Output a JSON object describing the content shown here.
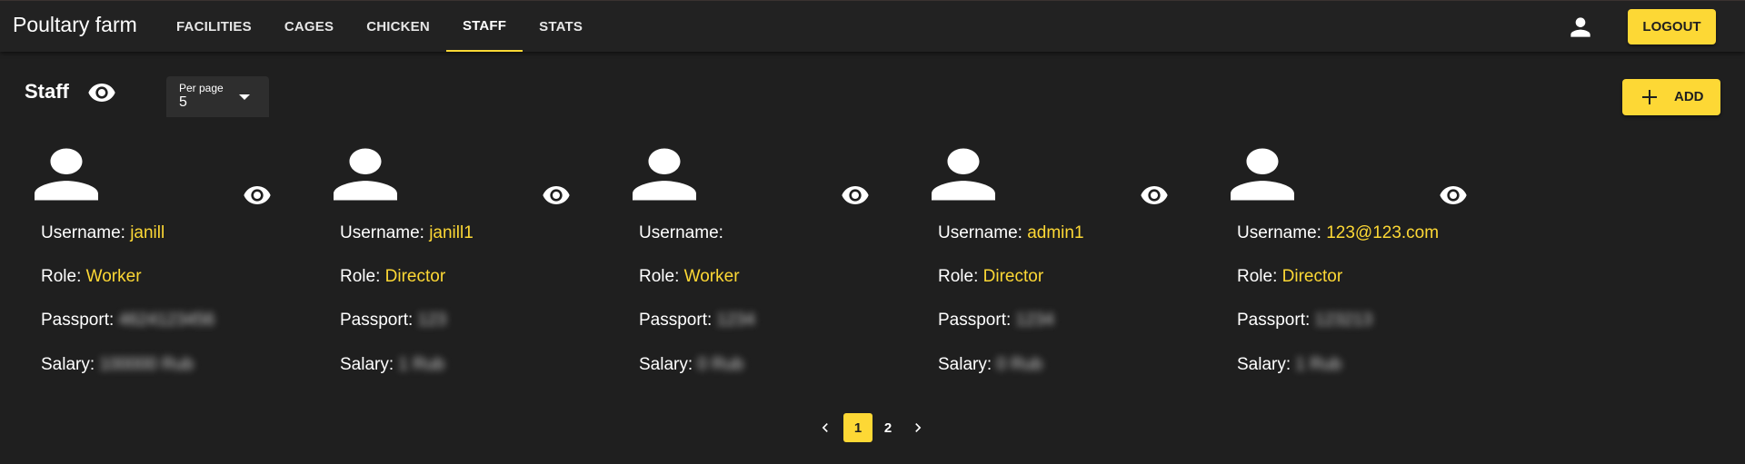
{
  "app": {
    "title": "Poultary farm"
  },
  "nav": {
    "tabs": [
      {
        "label": "FACILITIES",
        "active": false
      },
      {
        "label": "CAGES",
        "active": false
      },
      {
        "label": "CHICKEN",
        "active": false
      },
      {
        "label": "STAFF",
        "active": true
      },
      {
        "label": "STATS",
        "active": false
      }
    ]
  },
  "header": {
    "user_icon": "account-icon",
    "logout_label": "LOGOUT"
  },
  "page": {
    "title": "Staff",
    "title_icon": "eye-icon",
    "per_page": {
      "label": "Per page",
      "value": "5"
    },
    "add_label": "ADD"
  },
  "labels": {
    "username": "Username:",
    "role": "Role:",
    "passport": "Passport:",
    "salary": "Salary:"
  },
  "staff": [
    {
      "username": "janill",
      "role": "Worker",
      "passport": "4624123456",
      "salary": "100000 Rub"
    },
    {
      "username": "janill1",
      "role": "Director",
      "passport": "123",
      "salary": "1 Rub"
    },
    {
      "username": "",
      "role": "Worker",
      "passport": "1234",
      "salary": "0 Rub"
    },
    {
      "username": "admin1",
      "role": "Director",
      "passport": "1234",
      "salary": "0 Rub"
    },
    {
      "username": "123@123.com",
      "role": "Director",
      "passport": "123213",
      "salary": "1 Rub"
    }
  ],
  "pagination": {
    "pages": [
      "1",
      "2"
    ],
    "current": "1"
  },
  "colors": {
    "accent": "#fdd835",
    "background": "#1f1f1f",
    "bar": "#222222"
  }
}
